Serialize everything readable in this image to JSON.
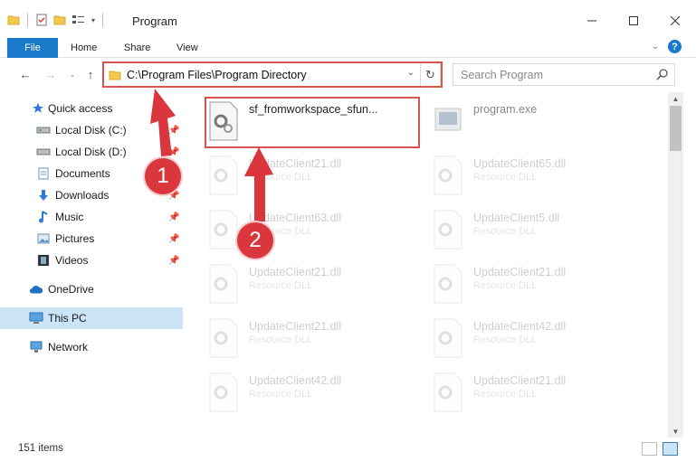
{
  "window": {
    "title": "Program"
  },
  "ribbon": {
    "file": "File",
    "home": "Home",
    "share": "Share",
    "view": "View",
    "help": "?"
  },
  "address": {
    "path": "C:\\Program Files\\Program Directory"
  },
  "search": {
    "placeholder": "Search Program"
  },
  "sidebar": {
    "items": [
      {
        "label": "Quick access"
      },
      {
        "label": "Local Disk (C:)"
      },
      {
        "label": "Local Disk (D:)"
      },
      {
        "label": "Documents"
      },
      {
        "label": "Downloads"
      },
      {
        "label": "Music"
      },
      {
        "label": "Pictures"
      },
      {
        "label": "Videos"
      },
      {
        "label": "OneDrive"
      },
      {
        "label": "This PC"
      },
      {
        "label": "Network"
      }
    ]
  },
  "files": [
    {
      "name": "sf_fromworkspace_sfun...",
      "type": ""
    },
    {
      "name": "program.exe",
      "type": ""
    },
    {
      "name": "UpdateClient21.dll",
      "type": "Resource DLL"
    },
    {
      "name": "UpdateClient65.dll",
      "type": "Resource DLL"
    },
    {
      "name": "UpdateClient63.dll",
      "type": "Resource DLL"
    },
    {
      "name": "UpdateClient5.dll",
      "type": "Resource DLL"
    },
    {
      "name": "UpdateClient21.dll",
      "type": "Resource DLL"
    },
    {
      "name": "UpdateClient21.dll",
      "type": "Resource DLL"
    },
    {
      "name": "UpdateClient21.dll",
      "type": "Resource DLL"
    },
    {
      "name": "UpdateClient42.dll",
      "type": "Resource DLL"
    },
    {
      "name": "UpdateClient42.dll",
      "type": "Resource DLL"
    },
    {
      "name": "UpdateClient21.dll",
      "type": "Resource DLL"
    }
  ],
  "status": {
    "count": "151 items"
  },
  "annotations": {
    "step1": "1",
    "step2": "2"
  },
  "colors": {
    "accent": "#1979ca",
    "annotation": "#d9373d",
    "selection": "#cce4f7"
  }
}
